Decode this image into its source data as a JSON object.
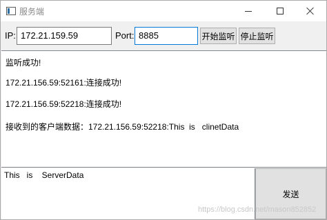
{
  "window": {
    "title": "服务端"
  },
  "toolbar": {
    "ip_label": "IP:",
    "ip_value": "172.21.159.59",
    "port_label": "Port:",
    "port_value": "8885",
    "start_label": "开始监听",
    "stop_label": "停止监听"
  },
  "log": {
    "lines": [
      "监听成功!",
      "172.21.156.59:52161:连接成功!",
      "172.21.156.59:52218:连接成功!",
      "接收到的客户端数据：172.21.156.59:52218:This  is   clinetData"
    ]
  },
  "input": {
    "value": "This   is    ServerData",
    "watermark": "https://blog.csdn.net/mason852852"
  },
  "send": {
    "label": "发送"
  },
  "icons": {
    "app": "app-icon",
    "minimize": "minimize-icon",
    "maximize": "maximize-icon",
    "close": "close-icon"
  }
}
